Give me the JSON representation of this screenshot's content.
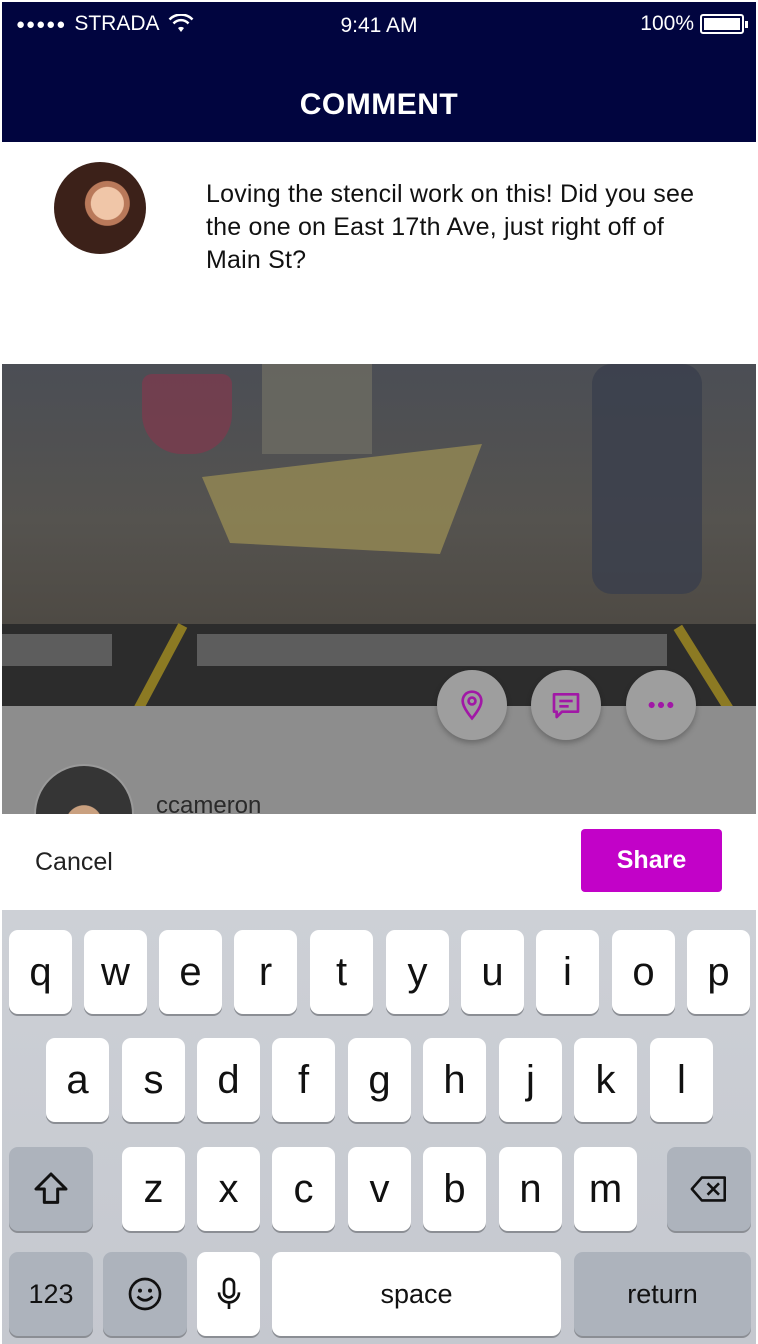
{
  "status": {
    "carrier": "STRADA",
    "signal": "●●●●●",
    "time": "9:41 AM",
    "battery": "100%"
  },
  "nav": {
    "title": "COMMENT"
  },
  "comment": {
    "text": "Loving the stencil work on this! Did you see the one on East 17th Ave, just right off of Main St?"
  },
  "post": {
    "username": "ccameron"
  },
  "actions": {
    "cancel": "Cancel",
    "share": "Share"
  },
  "icons": {
    "location": "location-pin-icon",
    "comment": "comment-icon",
    "more": "more-icon"
  },
  "colors": {
    "nav": "#01053f",
    "accent": "#c202c8"
  },
  "keyboard": {
    "row1": [
      "q",
      "w",
      "e",
      "r",
      "t",
      "y",
      "u",
      "i",
      "o",
      "p"
    ],
    "row2": [
      "a",
      "s",
      "d",
      "f",
      "g",
      "h",
      "j",
      "k",
      "l"
    ],
    "row3": [
      "z",
      "x",
      "c",
      "v",
      "b",
      "n",
      "m"
    ],
    "num": "123",
    "space": "space",
    "return": "return"
  }
}
